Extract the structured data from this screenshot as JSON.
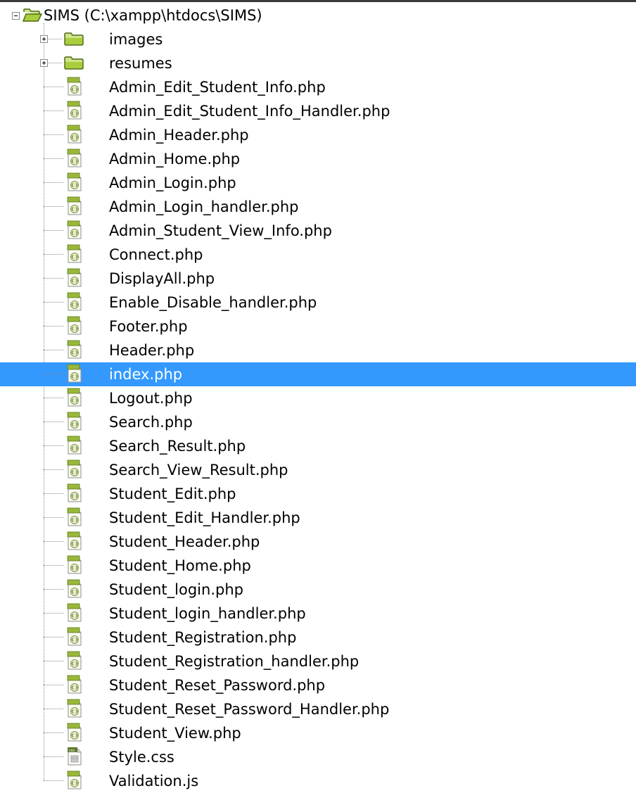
{
  "root": {
    "label": "SIMS (C:\\xampp\\htdocs\\SIMS)",
    "icon": "folder-open-icon",
    "expanded": true
  },
  "selected_color": "#3399ff",
  "items": [
    {
      "label": "images",
      "type": "folder",
      "icon": "folder-icon",
      "expandable": true
    },
    {
      "label": "resumes",
      "type": "folder",
      "icon": "folder-icon",
      "expandable": true
    },
    {
      "label": "Admin_Edit_Student_Info.php",
      "type": "php",
      "icon": "php-file-icon"
    },
    {
      "label": "Admin_Edit_Student_Info_Handler.php",
      "type": "php",
      "icon": "php-file-icon"
    },
    {
      "label": "Admin_Header.php",
      "type": "php",
      "icon": "php-file-icon"
    },
    {
      "label": "Admin_Home.php",
      "type": "php",
      "icon": "php-file-icon"
    },
    {
      "label": "Admin_Login.php",
      "type": "php",
      "icon": "php-file-icon"
    },
    {
      "label": "Admin_Login_handler.php",
      "type": "php",
      "icon": "php-file-icon"
    },
    {
      "label": "Admin_Student_View_Info.php",
      "type": "php",
      "icon": "php-file-icon"
    },
    {
      "label": "Connect.php",
      "type": "php",
      "icon": "php-file-icon"
    },
    {
      "label": "DisplayAll.php",
      "type": "php",
      "icon": "php-file-icon"
    },
    {
      "label": "Enable_Disable_handler.php",
      "type": "php",
      "icon": "php-file-icon"
    },
    {
      "label": "Footer.php",
      "type": "php",
      "icon": "php-file-icon"
    },
    {
      "label": "Header.php",
      "type": "php",
      "icon": "php-file-icon"
    },
    {
      "label": "index.php",
      "type": "php",
      "icon": "php-file-icon",
      "selected": true
    },
    {
      "label": "Logout.php",
      "type": "php",
      "icon": "php-file-icon"
    },
    {
      "label": "Search.php",
      "type": "php",
      "icon": "php-file-icon"
    },
    {
      "label": "Search_Result.php",
      "type": "php",
      "icon": "php-file-icon"
    },
    {
      "label": "Search_View_Result.php",
      "type": "php",
      "icon": "php-file-icon"
    },
    {
      "label": "Student_Edit.php",
      "type": "php",
      "icon": "php-file-icon"
    },
    {
      "label": "Student_Edit_Handler.php",
      "type": "php",
      "icon": "php-file-icon"
    },
    {
      "label": "Student_Header.php",
      "type": "php",
      "icon": "php-file-icon"
    },
    {
      "label": "Student_Home.php",
      "type": "php",
      "icon": "php-file-icon"
    },
    {
      "label": "Student_login.php",
      "type": "php",
      "icon": "php-file-icon"
    },
    {
      "label": "Student_login_handler.php",
      "type": "php",
      "icon": "php-file-icon"
    },
    {
      "label": "Student_Registration.php",
      "type": "php",
      "icon": "php-file-icon"
    },
    {
      "label": "Student_Registration_handler.php",
      "type": "php",
      "icon": "php-file-icon"
    },
    {
      "label": "Student_Reset_Password.php",
      "type": "php",
      "icon": "php-file-icon"
    },
    {
      "label": "Student_Reset_Password_Handler.php",
      "type": "php",
      "icon": "php-file-icon"
    },
    {
      "label": "Student_View.php",
      "type": "php",
      "icon": "php-file-icon"
    },
    {
      "label": "Style.css",
      "type": "css",
      "icon": "css-file-icon"
    },
    {
      "label": "Validation.js",
      "type": "js",
      "icon": "js-file-icon"
    }
  ]
}
